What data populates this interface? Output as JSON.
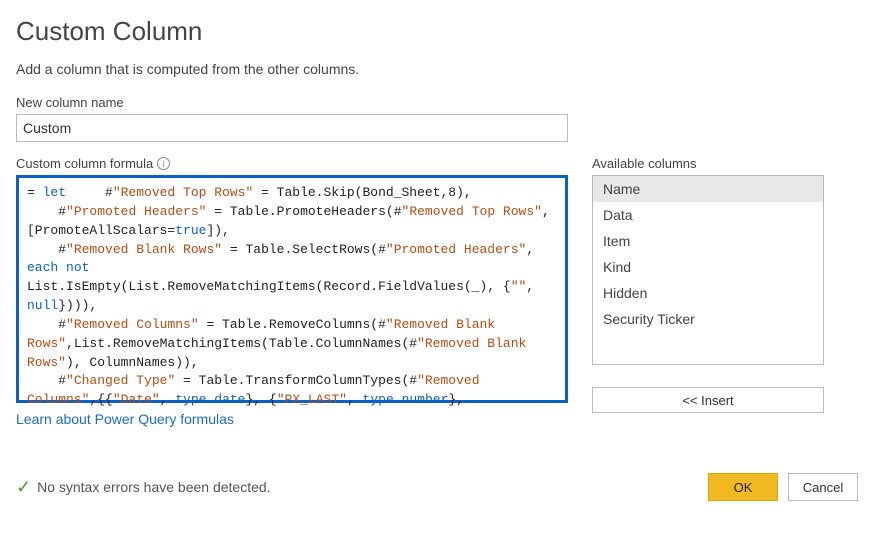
{
  "title": "Custom Column",
  "subtitle": "Add a column that is computed from the other columns.",
  "newColName": {
    "label": "New column name",
    "value": "Custom"
  },
  "formula": {
    "label": "Custom column formula",
    "tokens": [
      {
        "t": "= ",
        "c": ""
      },
      {
        "t": "let",
        "c": "kw"
      },
      {
        "t": "     #",
        "c": ""
      },
      {
        "t": "\"Removed Top Rows\"",
        "c": "str"
      },
      {
        "t": " = Table.Skip(Bond_Sheet,8),\n",
        "c": ""
      },
      {
        "t": "    #",
        "c": ""
      },
      {
        "t": "\"Promoted Headers\"",
        "c": "str"
      },
      {
        "t": " = Table.PromoteHeaders(#",
        "c": ""
      },
      {
        "t": "\"Removed Top Rows\"",
        "c": "str"
      },
      {
        "t": ", [PromoteAllScalars=",
        "c": ""
      },
      {
        "t": "true",
        "c": "kw"
      },
      {
        "t": "]),\n",
        "c": ""
      },
      {
        "t": "    #",
        "c": ""
      },
      {
        "t": "\"Removed Blank Rows\"",
        "c": "str"
      },
      {
        "t": " = Table.SelectRows(#",
        "c": ""
      },
      {
        "t": "\"Promoted Headers\"",
        "c": "str"
      },
      {
        "t": ", ",
        "c": ""
      },
      {
        "t": "each",
        "c": "kw"
      },
      {
        "t": " ",
        "c": ""
      },
      {
        "t": "not",
        "c": "kw"
      },
      {
        "t": " List.IsEmpty(List.RemoveMatchingItems(Record.FieldValues(_), {",
        "c": ""
      },
      {
        "t": "\"\"",
        "c": "str"
      },
      {
        "t": ", ",
        "c": ""
      },
      {
        "t": "null",
        "c": "kw"
      },
      {
        "t": "}))),\n",
        "c": ""
      },
      {
        "t": "    #",
        "c": ""
      },
      {
        "t": "\"Removed Columns\"",
        "c": "str"
      },
      {
        "t": " = Table.RemoveColumns(#",
        "c": ""
      },
      {
        "t": "\"Removed Blank Rows\"",
        "c": "str"
      },
      {
        "t": ",List.RemoveMatchingItems(Table.ColumnNames(#",
        "c": ""
      },
      {
        "t": "\"Removed Blank Rows\"",
        "c": "str"
      },
      {
        "t": "), ColumnNames)),\n",
        "c": ""
      },
      {
        "t": "    #",
        "c": ""
      },
      {
        "t": "\"Changed Type\"",
        "c": "str"
      },
      {
        "t": " = Table.TransformColumnTypes(#",
        "c": ""
      },
      {
        "t": "\"Removed Columns\"",
        "c": "str"
      },
      {
        "t": ",{{",
        "c": ""
      },
      {
        "t": "\"Date\"",
        "c": "str"
      },
      {
        "t": ", ",
        "c": ""
      },
      {
        "t": "type",
        "c": "kw"
      },
      {
        "t": " ",
        "c": ""
      },
      {
        "t": "date",
        "c": "kw"
      },
      {
        "t": "}, {",
        "c": ""
      },
      {
        "t": "\"PX_LAST\"",
        "c": "str"
      },
      {
        "t": ", ",
        "c": ""
      },
      {
        "t": "type",
        "c": "kw"
      },
      {
        "t": " ",
        "c": ""
      },
      {
        "t": "number",
        "c": "kw"
      },
      {
        "t": "},",
        "c": ""
      }
    ]
  },
  "available": {
    "label": "Available columns",
    "items": [
      "Name",
      "Data",
      "Item",
      "Kind",
      "Hidden",
      "Security Ticker"
    ],
    "selected": 0
  },
  "insertLabel": "<< Insert",
  "learnLink": "Learn about Power Query formulas",
  "status": "No syntax errors have been detected.",
  "okLabel": "OK",
  "cancelLabel": "Cancel"
}
